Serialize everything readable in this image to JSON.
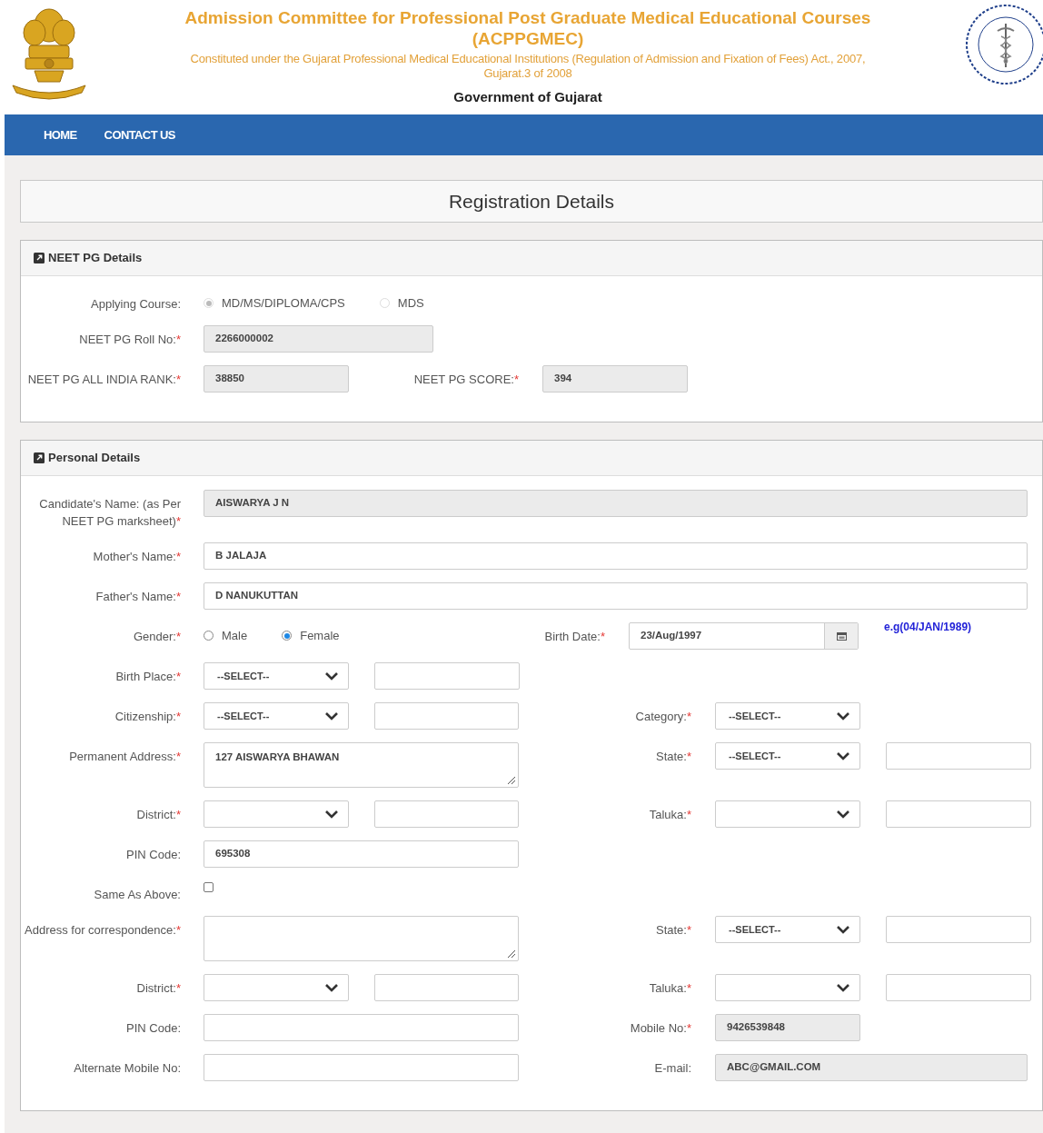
{
  "header": {
    "title_lines": [
      "Admission Committee for Professional Post Graduate Medical Educational Courses",
      "(ACPPGMEC)"
    ],
    "subtitle_lines": [
      "Constituted under the Gujarat Professional Medical Educational Institutions (Regulation of Admission and Fixation of Fees) Act., 2007,",
      "Gujarat.3 of 2008"
    ],
    "government": "Government of Gujarat"
  },
  "nav": [
    {
      "label": "HOME"
    },
    {
      "label": "CONTACT US"
    }
  ],
  "page_title": "Registration Details",
  "sections": [
    {
      "title": "NEET PG Details",
      "rows": [
        {
          "label": "Applying Course:",
          "items": [
            {
              "kind": "radio",
              "label": "MD/MS/DIPLOMA/CPS",
              "selected": true,
              "disabled": true
            },
            {
              "kind": "radio",
              "label": "MDS",
              "selected": false,
              "disabled": true
            }
          ]
        },
        {
          "label": "NEET PG Roll No:",
          "mark": "*",
          "items": [
            {
              "kind": "midinput",
              "value": "2266000002",
              "readonly": true
            }
          ]
        },
        {
          "label": "NEET PG ALL INDIA RANK:",
          "mark": "*",
          "items": [
            {
              "kind": "input",
              "value": "38850",
              "readonly": true
            }
          ],
          "right": {
            "label": "NEET PG SCORE:",
            "mark": "*",
            "items": [
              {
                "kind": "input",
                "value": "394",
                "readonly": true
              }
            ]
          }
        }
      ]
    },
    {
      "title": "Personal Details",
      "rows": [
        {
          "label": "Candidate's Name: (as Per NEET PG marksheet)",
          "mark": "*",
          "items": [
            {
              "kind": "wideinput",
              "value": "AISWARYA J N",
              "readonly": true
            }
          ]
        },
        {
          "label": "Mother's Name:",
          "mark": "*",
          "items": [
            {
              "kind": "wideinput",
              "value": "B JALAJA",
              "readonly": false
            }
          ]
        },
        {
          "label": "Father's Name:",
          "mark": "*",
          "items": [
            {
              "kind": "wideinput",
              "value": "D NANUKUTTAN",
              "readonly": false
            }
          ]
        },
        {
          "label": "Gender:",
          "mark": "*",
          "items": [
            {
              "kind": "radio",
              "label": "Male",
              "selected": false,
              "disabled": false
            },
            {
              "kind": "radio",
              "label": "Female",
              "selected": true,
              "disabled": false
            }
          ],
          "right": {
            "label": "Birth Date:",
            "mark": "*",
            "items": [
              {
                "kind": "date",
                "value": "23/Aug/1997"
              },
              {
                "kind": "hint",
                "text": "e.g(04/JAN/1989)"
              }
            ]
          }
        },
        {
          "label": "Birth Place:",
          "mark": "*",
          "items": [
            {
              "kind": "select",
              "value": "--SELECT--"
            },
            {
              "kind": "input",
              "readonly": false
            }
          ]
        },
        {
          "label": "Citizenship:",
          "mark": "*",
          "items": [
            {
              "kind": "select",
              "value": "--SELECT--"
            },
            {
              "kind": "input",
              "readonly": false
            }
          ],
          "right": {
            "label": "Category:",
            "mark": "*",
            "items": [
              {
                "kind": "select",
                "value": "--SELECT--"
              }
            ]
          }
        },
        {
          "label": "Permanent Address:",
          "mark": "*",
          "items": [
            {
              "kind": "textarea",
              "value": "127 AISWARYA BHAWAN"
            }
          ],
          "right": {
            "label": "State:",
            "mark": "*",
            "items": [
              {
                "kind": "select",
                "value": "--SELECT--"
              },
              {
                "kind": "input",
                "readonly": false
              }
            ]
          }
        },
        {
          "label": "District:",
          "mark": "*",
          "items": [
            {
              "kind": "select"
            },
            {
              "kind": "input",
              "readonly": false
            }
          ],
          "right": {
            "label": "Taluka:",
            "mark": "*",
            "items": [
              {
                "kind": "select"
              },
              {
                "kind": "input",
                "readonly": false
              }
            ]
          }
        },
        {
          "label": "PIN Code:",
          "items": [
            {
              "kind": "longinput",
              "value": "695308",
              "readonly": false
            }
          ]
        },
        {
          "label": "Same As Above:",
          "items": [
            {
              "kind": "checkbox",
              "checked": false
            }
          ]
        },
        {
          "label": "Address for correspondence:",
          "mark": "*",
          "items": [
            {
              "kind": "textarea"
            }
          ],
          "right": {
            "label": "State:",
            "mark": "*",
            "items": [
              {
                "kind": "select",
                "value": "--SELECT--"
              },
              {
                "kind": "input",
                "readonly": false
              }
            ]
          }
        },
        {
          "label": "District:",
          "mark": "*",
          "items": [
            {
              "kind": "select"
            },
            {
              "kind": "input",
              "readonly": false
            }
          ],
          "right": {
            "label": "Taluka:",
            "mark": "*",
            "items": [
              {
                "kind": "select"
              },
              {
                "kind": "input",
                "readonly": false
              }
            ]
          }
        },
        {
          "label": "PIN Code:",
          "items": [
            {
              "kind": "longinput",
              "readonly": false
            }
          ],
          "right": {
            "label": "Mobile No:",
            "mark": "*",
            "items": [
              {
                "kind": "input",
                "value": "9426539848",
                "readonly": true
              }
            ]
          }
        },
        {
          "label": "Alternate Mobile No:",
          "items": [
            {
              "kind": "longinput",
              "readonly": false
            }
          ],
          "right": {
            "label": "E-mail:",
            "items": [
              {
                "kind": "wideinput",
                "value": "ABC@GMAIL.COM",
                "readonly": true
              }
            ]
          }
        }
      ]
    }
  ]
}
